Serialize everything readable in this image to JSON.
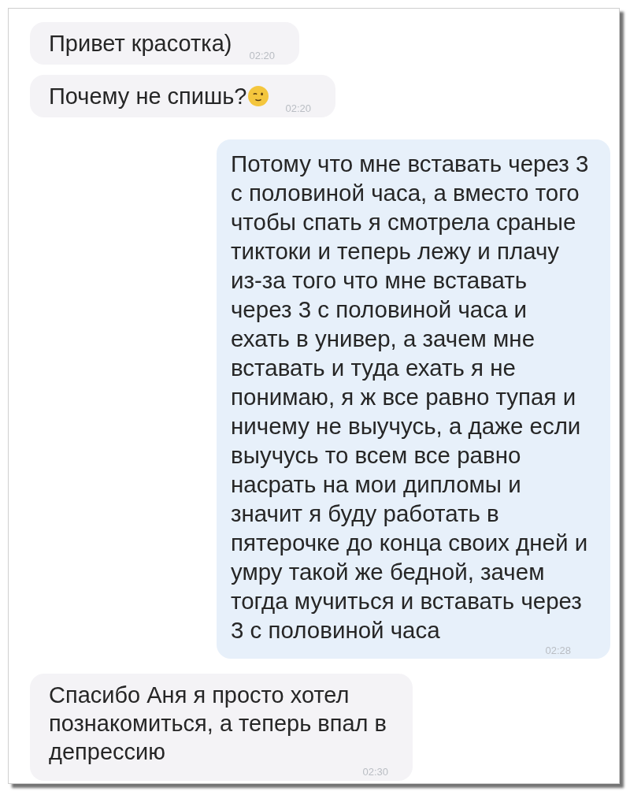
{
  "messages": [
    {
      "kind": "incoming",
      "text": "Привет красотка)",
      "emoji": false,
      "time": "02:20"
    },
    {
      "kind": "incoming",
      "text": "Почему не спишь?",
      "emoji": true,
      "time": "02:20"
    },
    {
      "kind": "outgoing",
      "text": "Потому что мне вставать через 3\nс половиной часа, а вместо того\nчтобы спать я смотрела сраные\nтиктоки и теперь лежу и плачу\nиз-за того что мне вставать\nчерез 3 с половиной часа и\nехать в универ, а зачем мне\nвставать и туда ехать я не\nпонимаю, я ж все равно тупая и\nничему не выучусь, а даже если\nвыучусь то всем все равно\nнасрать на мои дипломы и\nзначит я буду работать в\nпятерочке до конца своих дней и\nумру такой же бедной, зачем\nтогда мучиться и вставать через\n3 с половиной часа",
      "emoji": false,
      "time": "02:28"
    },
    {
      "kind": "incoming",
      "text": "Спасибо Аня я просто хотел\nпознакомиться, а теперь впал в\nдепрессию",
      "emoji": false,
      "time": "02:30"
    }
  ]
}
